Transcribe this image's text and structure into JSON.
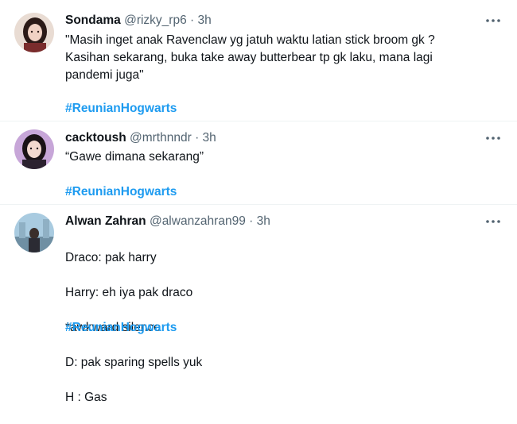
{
  "tweets": [
    {
      "name": "Sondama",
      "handle": "@rizky_rp6",
      "separator": "·",
      "time": "3h",
      "text": "\"Masih inget anak Ravenclaw yg jatuh waktu latian stick broom gk ?\nKasihan sekarang, buka take away butterbear tp gk laku, mana lagi\npandemi juga\"",
      "hashtag": "#ReunianHogwarts",
      "more_icon": "more-horizontal-icon"
    },
    {
      "name": "cacktoush",
      "handle": "@mrthnndr",
      "separator": "·",
      "time": "3h",
      "text": "“Gawe dimana sekarang”",
      "hashtag": "#ReunianHogwarts",
      "more_icon": "more-horizontal-icon"
    },
    {
      "name": "Alwan Zahran",
      "handle": "@alwanzahran99",
      "separator": "·",
      "time": "3h",
      "lines": [
        "Draco: pak harry",
        "Harry: eh iya pak draco",
        "*awkward silence",
        "D: pak sparing spells yuk",
        "H : Gas"
      ],
      "hashtag": "#ReunianHogwarts",
      "more_icon": "more-horizontal-icon"
    }
  ],
  "colors": {
    "text": "#0f1419",
    "secondary": "#536471",
    "link": "#1d9bf0",
    "divider": "#eff3f4"
  }
}
